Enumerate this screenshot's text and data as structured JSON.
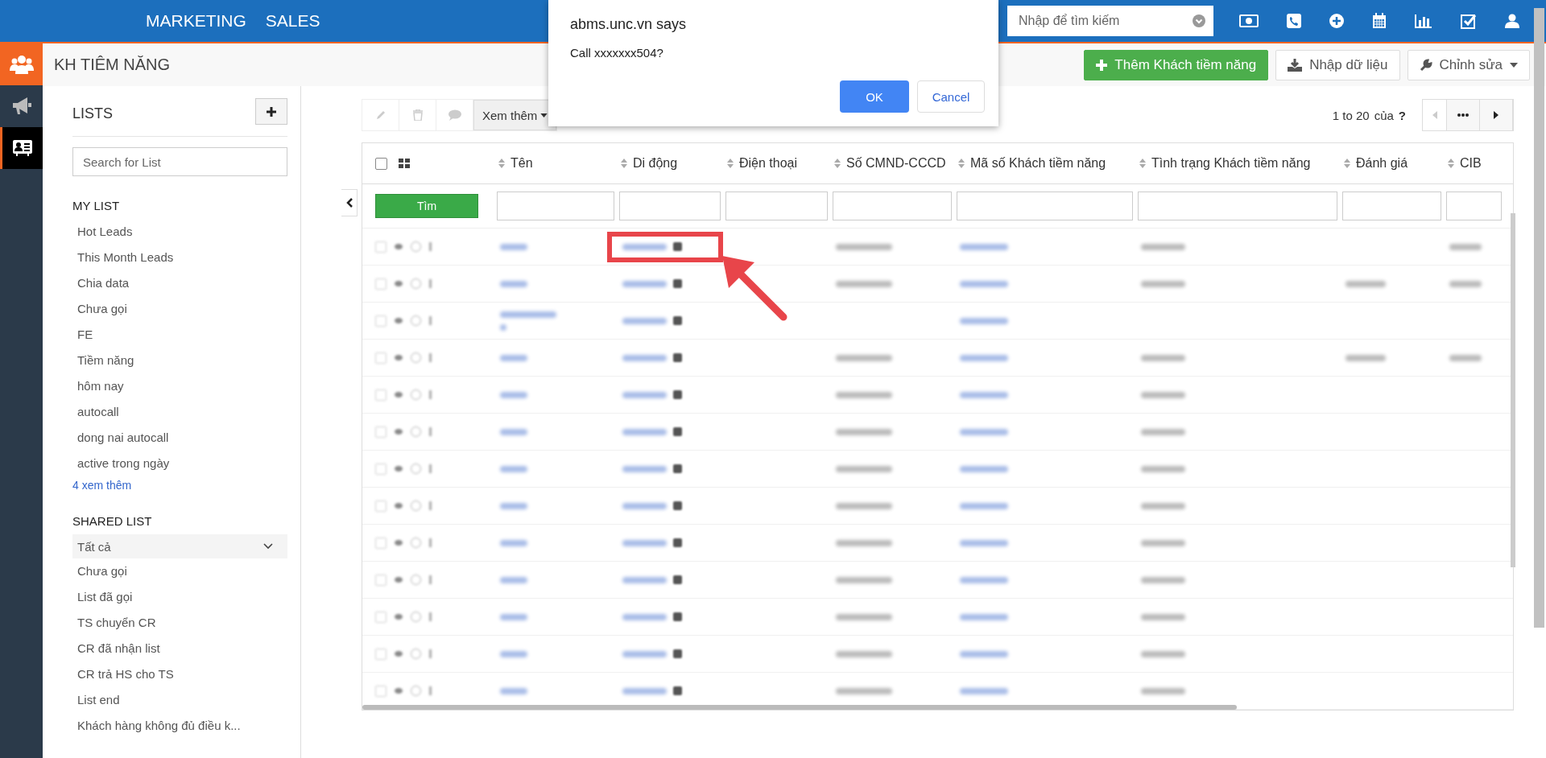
{
  "top_nav": {
    "items": [
      "MARKETING",
      "SALES"
    ],
    "search": {
      "placeholder": "Nhập để tìm kiếm"
    }
  },
  "rail": {
    "items": [
      {
        "kind": "people",
        "selected": false,
        "accent": true
      },
      {
        "kind": "megaphone",
        "selected": false,
        "accent": false
      },
      {
        "kind": "card",
        "selected": true,
        "accent": false
      }
    ]
  },
  "page": {
    "title": "KH TIÊM NĂNG",
    "actions": [
      {
        "kind": "primary",
        "label": "Thêm Khách tiềm năng"
      },
      {
        "kind": "import",
        "label": "Nhập dữ liệu"
      },
      {
        "kind": "menu",
        "label": "Chỉnh sửa"
      }
    ]
  },
  "lists": {
    "title": "LISTS",
    "search": {
      "placeholder": "Search for List"
    },
    "my_list": {
      "title": "MY LIST",
      "items": [
        "Hot Leads",
        "This Month Leads",
        "Chia data",
        "Chưa gọi",
        "FE",
        "Tiềm năng",
        "hôm nay",
        "autocall",
        "dong nai autocall",
        "active trong ngày"
      ],
      "more": "4 xem thêm"
    },
    "shared_list": {
      "title": "SHARED LIST",
      "dropdown": "Tất cả",
      "items": [
        "Chưa gọi",
        "List đã gọi",
        "TS chuyển CR",
        "CR đã nhận list",
        "CR trả HS cho TS",
        "List end",
        "Khách hàng không đủ điều k..."
      ]
    }
  },
  "toolbar": {
    "more": "Xem thêm",
    "pagination": {
      "range": "1 to 20",
      "of": "của",
      "total": "?"
    }
  },
  "table": {
    "search_button": "Tìm",
    "select_all_checked": false,
    "columns": [
      "Tên",
      "Di động",
      "Điện thoại",
      "Số CMND-CCCD",
      "Mã số Khách tiềm năng",
      "Tình trạng Khách tiềm năng",
      "Đánh giá",
      "CIB"
    ],
    "rows": [
      {
        "cells": [
          {
            "kind": "link"
          },
          {
            "kind": "link",
            "highlighted": true
          },
          {
            "kind": "none"
          },
          {
            "kind": "text"
          },
          {
            "kind": "link"
          },
          {
            "kind": "text"
          },
          {
            "kind": "none"
          },
          {
            "kind": "text"
          }
        ]
      },
      {
        "cells": [
          {
            "kind": "link"
          },
          {
            "kind": "link",
            "highlighted": false
          },
          {
            "kind": "none"
          },
          {
            "kind": "text"
          },
          {
            "kind": "link"
          },
          {
            "kind": "text"
          },
          {
            "kind": "text"
          },
          {
            "kind": "text"
          }
        ]
      },
      {
        "cells": [
          {
            "kind": "link2"
          },
          {
            "kind": "link",
            "highlighted": false
          },
          {
            "kind": "none"
          },
          {
            "kind": "none"
          },
          {
            "kind": "link"
          },
          {
            "kind": "none"
          },
          {
            "kind": "none"
          },
          {
            "kind": "none"
          }
        ]
      },
      {
        "cells": [
          {
            "kind": "link"
          },
          {
            "kind": "link",
            "highlighted": false
          },
          {
            "kind": "none"
          },
          {
            "kind": "text"
          },
          {
            "kind": "link"
          },
          {
            "kind": "text"
          },
          {
            "kind": "text"
          },
          {
            "kind": "text"
          }
        ]
      },
      {
        "cells": [
          {
            "kind": "link"
          },
          {
            "kind": "link",
            "highlighted": false
          },
          {
            "kind": "none"
          },
          {
            "kind": "text"
          },
          {
            "kind": "link"
          },
          {
            "kind": "text"
          },
          {
            "kind": "none"
          },
          {
            "kind": "none"
          }
        ]
      },
      {
        "cells": [
          {
            "kind": "link"
          },
          {
            "kind": "link",
            "highlighted": false
          },
          {
            "kind": "none"
          },
          {
            "kind": "text"
          },
          {
            "kind": "link"
          },
          {
            "kind": "text"
          },
          {
            "kind": "none"
          },
          {
            "kind": "none"
          }
        ]
      },
      {
        "cells": [
          {
            "kind": "link"
          },
          {
            "kind": "link",
            "highlighted": false
          },
          {
            "kind": "none"
          },
          {
            "kind": "text"
          },
          {
            "kind": "link"
          },
          {
            "kind": "text"
          },
          {
            "kind": "none"
          },
          {
            "kind": "none"
          }
        ]
      },
      {
        "cells": [
          {
            "kind": "link"
          },
          {
            "kind": "link",
            "highlighted": false
          },
          {
            "kind": "none"
          },
          {
            "kind": "text"
          },
          {
            "kind": "link"
          },
          {
            "kind": "text"
          },
          {
            "kind": "none"
          },
          {
            "kind": "none"
          }
        ]
      },
      {
        "cells": [
          {
            "kind": "link"
          },
          {
            "kind": "link",
            "highlighted": false
          },
          {
            "kind": "none"
          },
          {
            "kind": "text"
          },
          {
            "kind": "link"
          },
          {
            "kind": "text"
          },
          {
            "kind": "none"
          },
          {
            "kind": "none"
          }
        ]
      },
      {
        "cells": [
          {
            "kind": "link"
          },
          {
            "kind": "link",
            "highlighted": false
          },
          {
            "kind": "none"
          },
          {
            "kind": "text"
          },
          {
            "kind": "link"
          },
          {
            "kind": "text"
          },
          {
            "kind": "none"
          },
          {
            "kind": "none"
          }
        ]
      },
      {
        "cells": [
          {
            "kind": "link"
          },
          {
            "kind": "link",
            "highlighted": false
          },
          {
            "kind": "none"
          },
          {
            "kind": "text"
          },
          {
            "kind": "link"
          },
          {
            "kind": "text"
          },
          {
            "kind": "none"
          },
          {
            "kind": "none"
          }
        ]
      },
      {
        "cells": [
          {
            "kind": "link"
          },
          {
            "kind": "link",
            "highlighted": false
          },
          {
            "kind": "none"
          },
          {
            "kind": "text"
          },
          {
            "kind": "link"
          },
          {
            "kind": "text"
          },
          {
            "kind": "none"
          },
          {
            "kind": "none"
          }
        ]
      },
      {
        "cells": [
          {
            "kind": "link"
          },
          {
            "kind": "link",
            "highlighted": false
          },
          {
            "kind": "none"
          },
          {
            "kind": "text"
          },
          {
            "kind": "link"
          },
          {
            "kind": "text"
          },
          {
            "kind": "none"
          },
          {
            "kind": "none"
          }
        ]
      }
    ]
  },
  "dialog": {
    "title": "abms.unc.vn says",
    "message": "Call xxxxxxx504?",
    "ok": "OK",
    "cancel": "Cancel"
  }
}
